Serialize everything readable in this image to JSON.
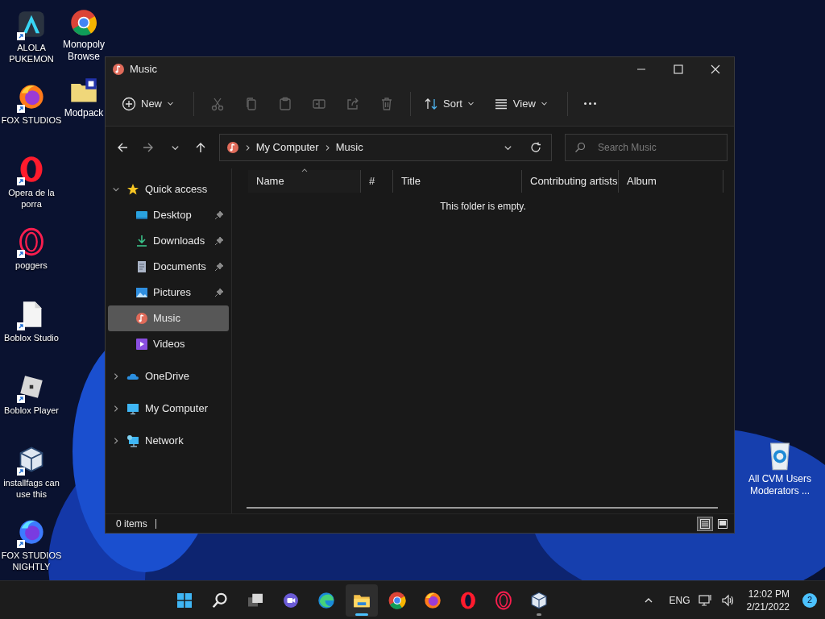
{
  "desktop": {
    "left_column": [
      {
        "label": "ALOLA PUKEMON",
        "kind": "a-app"
      },
      {
        "label": "FOX STUDIOS",
        "kind": "firefox"
      },
      {
        "label": "Opera de la porra",
        "kind": "opera"
      },
      {
        "label": "poggers",
        "kind": "opera-gx"
      },
      {
        "label": "Boblox Studio",
        "kind": "file"
      },
      {
        "label": "Boblox Player",
        "kind": "roblox"
      },
      {
        "label": "installfags can use this",
        "kind": "virtualbox"
      },
      {
        "label": "FOX STUDIOS NIGHTLY",
        "kind": "firefox-nightly"
      }
    ],
    "second_column": [
      {
        "label": "Monopoly Browse",
        "kind": "chrome"
      },
      {
        "label": "Modpack",
        "kind": "folder-zip"
      }
    ],
    "right_column": [
      {
        "label": "All CVM Users Moderators ...",
        "kind": "recycle-bin"
      }
    ]
  },
  "window": {
    "title": "Music",
    "toolbar": [
      {
        "kind": "new",
        "label": "New",
        "disabled": false
      },
      {
        "kind": "cut",
        "disabled": true
      },
      {
        "kind": "copy",
        "disabled": true
      },
      {
        "kind": "paste",
        "disabled": true
      },
      {
        "kind": "rename",
        "disabled": true
      },
      {
        "kind": "share",
        "disabled": true
      },
      {
        "kind": "delete",
        "disabled": true
      },
      {
        "kind": "sort",
        "label": "Sort",
        "disabled": false
      },
      {
        "kind": "view",
        "label": "View",
        "disabled": false
      },
      {
        "kind": "more",
        "disabled": false
      }
    ],
    "address": {
      "breadcrumbs": [
        "My Computer",
        "Music"
      ]
    },
    "search": {
      "placeholder": "Search Music"
    },
    "navigation": [
      {
        "label": "Quick access",
        "kind": "star",
        "expanded": true,
        "children": [
          {
            "label": "Desktop",
            "kind": "desktop",
            "pinned": true,
            "selected": false
          },
          {
            "label": "Downloads",
            "kind": "downloads",
            "pinned": true,
            "selected": false
          },
          {
            "label": "Documents",
            "kind": "documents",
            "pinned": true,
            "selected": false
          },
          {
            "label": "Pictures",
            "kind": "pictures",
            "pinned": true,
            "selected": false
          },
          {
            "label": "Music",
            "kind": "music",
            "pinned": false,
            "selected": true
          },
          {
            "label": "Videos",
            "kind": "videos",
            "pinned": false,
            "selected": false
          }
        ]
      },
      {
        "label": "OneDrive",
        "kind": "cloud",
        "expanded": false
      },
      {
        "label": "My Computer",
        "kind": "computer",
        "expanded": false
      },
      {
        "label": "Network",
        "kind": "network",
        "expanded": false
      }
    ],
    "columns": [
      {
        "label": "Name",
        "sorted": true
      },
      {
        "label": "#",
        "sorted": false
      },
      {
        "label": "Title",
        "sorted": false
      },
      {
        "label": "Contributing artists",
        "sorted": false
      },
      {
        "label": "Album",
        "sorted": false
      }
    ],
    "empty_message": "This folder is empty.",
    "status_bar": {
      "count": "0 items",
      "views": [
        {
          "kind": "details",
          "selected": true
        },
        {
          "kind": "tiles",
          "selected": false
        }
      ]
    }
  },
  "taskbar": {
    "apps": [
      {
        "kind": "start",
        "active": false,
        "running": false
      },
      {
        "kind": "search",
        "active": false,
        "running": false
      },
      {
        "kind": "task-view",
        "active": false,
        "running": false
      },
      {
        "kind": "chat",
        "active": false,
        "running": false
      },
      {
        "kind": "edge",
        "active": false,
        "running": false
      },
      {
        "kind": "explorer",
        "active": true,
        "running": true
      },
      {
        "kind": "chrome",
        "active": false,
        "running": false
      },
      {
        "kind": "firefox",
        "active": false,
        "running": false
      },
      {
        "kind": "opera",
        "active": false,
        "running": false
      },
      {
        "kind": "opera-gx",
        "active": false,
        "running": false
      },
      {
        "kind": "virtualbox",
        "active": false,
        "running": true
      }
    ],
    "language": "ENG",
    "time": "12:02 PM",
    "date": "2/21/2022",
    "notifications": "2"
  }
}
